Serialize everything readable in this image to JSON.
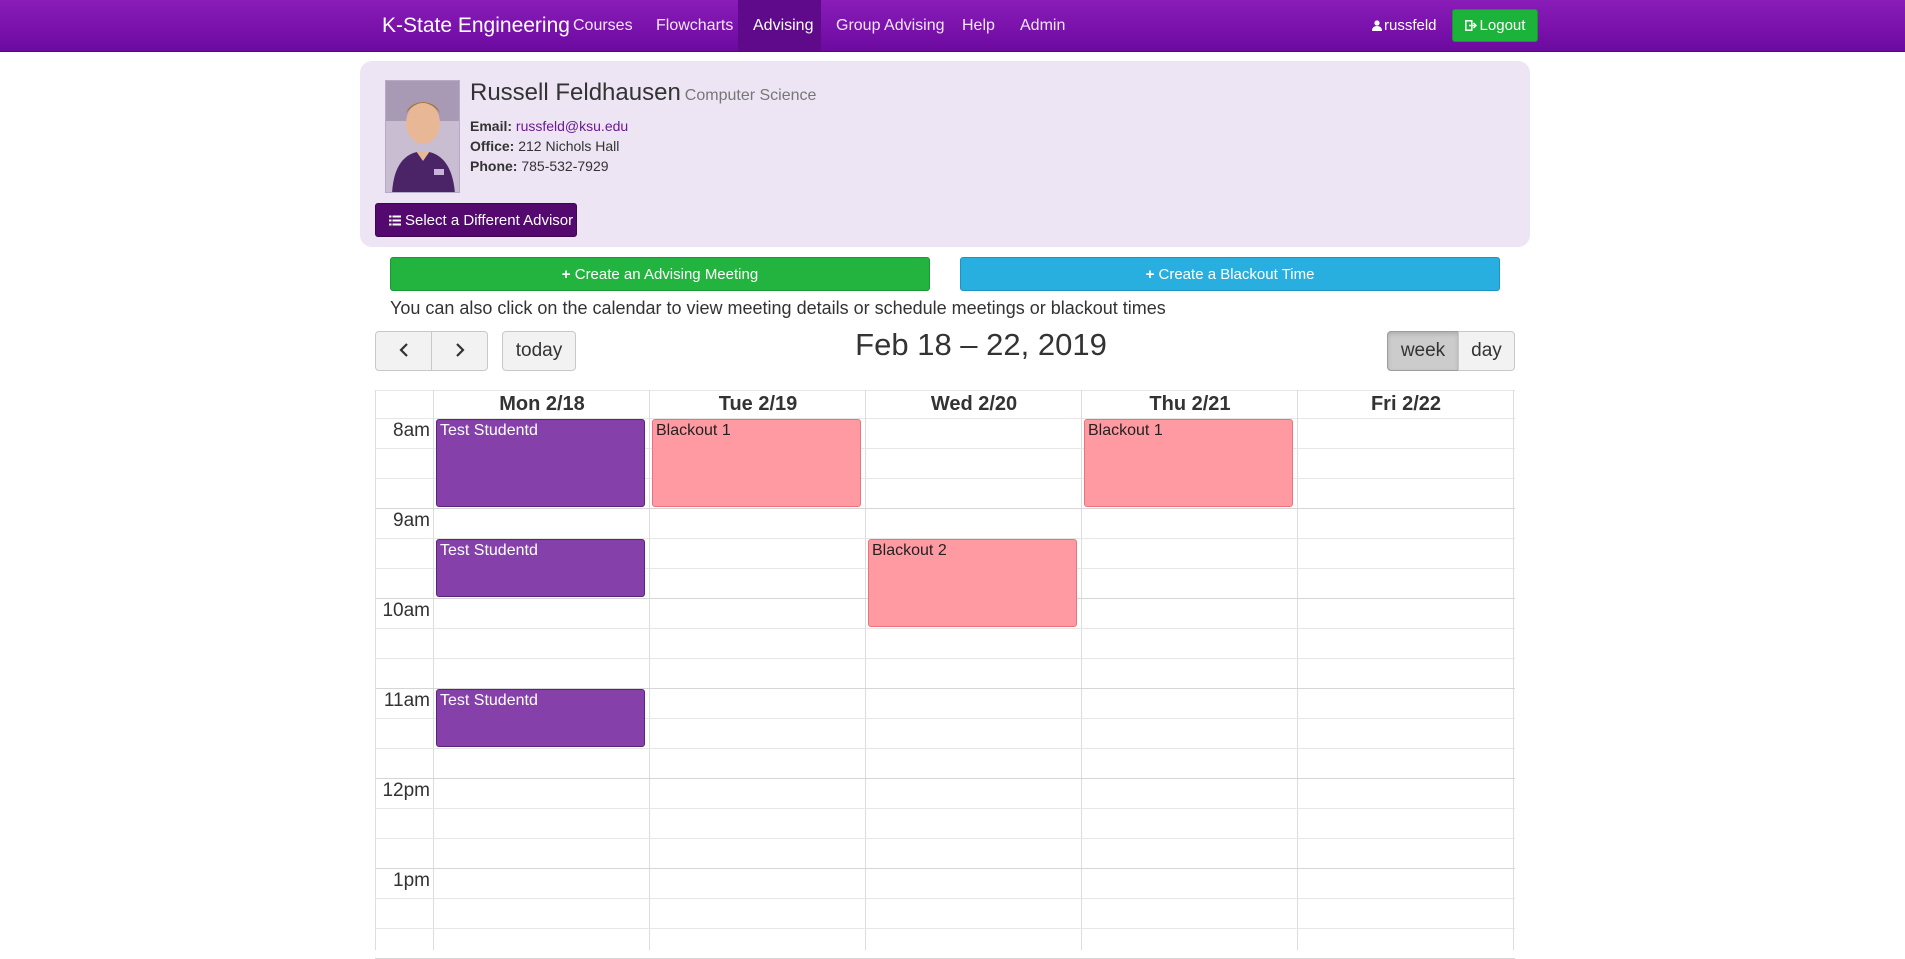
{
  "navbar": {
    "brand": "K-State Engineering",
    "items": [
      {
        "label": "Courses"
      },
      {
        "label": "Flowcharts"
      },
      {
        "label": "Advising"
      },
      {
        "label": "Group Advising"
      },
      {
        "label": "Help"
      },
      {
        "label": "Admin"
      }
    ],
    "active_item": "Advising",
    "user": "russfeld",
    "logout": "Logout",
    "bar_color": "#7b11aa"
  },
  "advisor": {
    "name": "Russell Feldhausen",
    "department": "Computer Science",
    "email_label": "Email:",
    "email": "russfeld@ksu.edu",
    "office_label": "Office:",
    "office": "212 Nichols Hall",
    "phone_label": "Phone:",
    "phone": "785-532-7929",
    "select_button": "Select a Different Advisor"
  },
  "actions": {
    "create_meeting": "Create an Advising Meeting",
    "create_blackout": "Create a Blackout Time",
    "hint": "You can also click on the calendar to view meeting details or schedule meetings or blackout times"
  },
  "calendar": {
    "title": "Feb 18 – 22, 2019",
    "today_label": "today",
    "view_week": "week",
    "view_day": "day",
    "active_view": "week",
    "days": [
      "Mon 2/18",
      "Tue 2/19",
      "Wed 2/20",
      "Thu 2/21",
      "Fri 2/22"
    ],
    "times": [
      "8am",
      "9am",
      "10am",
      "11am",
      "12pm",
      "1pm"
    ],
    "events": [
      {
        "day": 0,
        "start": "8:00",
        "end": "9:00",
        "title": "Test Studentd",
        "kind": "student"
      },
      {
        "day": 0,
        "start": "9:20",
        "end": "10:00",
        "title": "Test Studentd",
        "kind": "student"
      },
      {
        "day": 0,
        "start": "11:00",
        "end": "11:40",
        "title": "Test Studentd",
        "kind": "student"
      },
      {
        "day": 1,
        "start": "8:00",
        "end": "9:00",
        "title": "Blackout 1",
        "kind": "blackout"
      },
      {
        "day": 2,
        "start": "9:20",
        "end": "10:20",
        "title": "Blackout 2",
        "kind": "blackout"
      },
      {
        "day": 3,
        "start": "8:00",
        "end": "9:00",
        "title": "Blackout 1",
        "kind": "blackout"
      }
    ],
    "colors": {
      "student": "#8540aa",
      "blackout": "#ff9aa3"
    }
  }
}
